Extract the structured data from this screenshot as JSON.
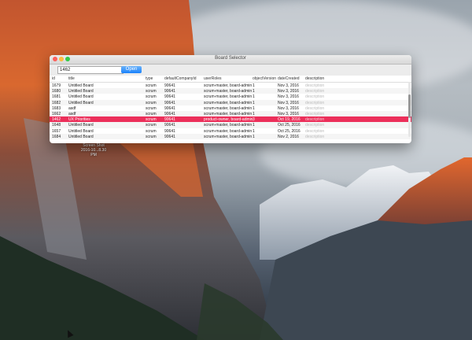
{
  "window": {
    "title": "Board Selector"
  },
  "toolbar": {
    "search_value": "1462",
    "open_label": "Open"
  },
  "columns": [
    "id",
    "title",
    "type",
    "defaultCompanyId",
    "userRoles",
    "objectVersion",
    "dateCreated",
    "description"
  ],
  "rows": [
    {
      "id": "1679",
      "title": "Untitled Board",
      "type": "scrum",
      "company": "90641",
      "roles": "scrum-master, board-admin",
      "version": "1",
      "date": "Nov 3, 2016",
      "desc": "description"
    },
    {
      "id": "1680",
      "title": "Untitled Board",
      "type": "scrum",
      "company": "90641",
      "roles": "scrum-master, board-admin",
      "version": "1",
      "date": "Nov 3, 2016",
      "desc": "description"
    },
    {
      "id": "1681",
      "title": "Untitled Board",
      "type": "scrum",
      "company": "90641",
      "roles": "scrum-master, board-admin",
      "version": "1",
      "date": "Nov 3, 2016",
      "desc": "description"
    },
    {
      "id": "1682",
      "title": "Untitled Board",
      "type": "scrum",
      "company": "90641",
      "roles": "scrum-master, board-admin",
      "version": "1",
      "date": "Nov 3, 2016",
      "desc": "description"
    },
    {
      "id": "1683",
      "title": "asdf",
      "type": "scrum",
      "company": "90641",
      "roles": "scrum-master, board-admin",
      "version": "1",
      "date": "Nov 3, 2016",
      "desc": "description"
    },
    {
      "id": "1662",
      "title": "asdf",
      "type": "scrum",
      "company": "90641",
      "roles": "scrum-master, board-admin",
      "version": "1",
      "date": "Nov 3, 2016",
      "desc": "description"
    },
    {
      "id": "1462",
      "title": "UX Priorities",
      "type": "scrum",
      "company": "90641",
      "roles": "product-owner, board-admin",
      "version": "3",
      "date": "Oct 19, 2016",
      "desc": "description",
      "selected": true
    },
    {
      "id": "1648",
      "title": "Untitled Board",
      "type": "scrum",
      "company": "90641",
      "roles": "scrum-master, board-admin",
      "version": "1",
      "date": "Oct 25, 2016",
      "desc": "description"
    },
    {
      "id": "1657",
      "title": "Untitled Board",
      "type": "scrum",
      "company": "90641",
      "roles": "scrum-master, board-admin",
      "version": "1",
      "date": "Oct 25, 2016",
      "desc": "description"
    },
    {
      "id": "1684",
      "title": "Untitled Board",
      "type": "scrum",
      "company": "90641",
      "roles": "scrum-master, board-admin",
      "version": "1",
      "date": "Nov 2, 2016",
      "desc": "description"
    }
  ],
  "desktop": {
    "icon_label_1": "Screen Shot",
    "icon_label_2": "2016-10...8.30 PM"
  },
  "colors": {
    "selection": "#ec2f5a",
    "open_button": "#1a82fb"
  }
}
